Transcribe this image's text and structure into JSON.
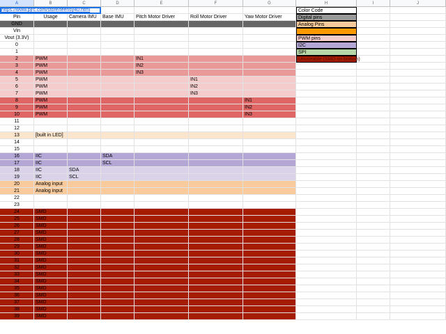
{
  "columns": [
    "A",
    "B",
    "C",
    "D",
    "E",
    "F",
    "G",
    "H",
    "I",
    "J"
  ],
  "selected_column": "A",
  "colors": {
    "digital": "#999999",
    "analog": "#f9cb9c",
    "pwm": "#f4cccc",
    "i2c": "#b4a7d6",
    "spi": "#b6d7a8",
    "smd": "#a61c00",
    "gnd_row": "#666666",
    "pwm_a": "#ea9999",
    "pwm_b": "#f4cccc",
    "pwm_c": "#e06666",
    "led_row": "#fce5cd",
    "i2c_row_a": "#b4a7d6",
    "i2c_row_b": "#d9d2e9",
    "analog_row": "#f9cb9c",
    "smd_row": "#a61c00"
  },
  "link_text": "https://www.pjrc.com/store/teensy40.html",
  "headers": {
    "pin": "Pin",
    "usage": "Usage",
    "camera_imu": "Camera IMU",
    "base_imu": "Base IMU",
    "pitch": "Pitch Motor Driver",
    "roll": "Roll  Motor Driver",
    "yaw": "Yaw Motor Driver"
  },
  "legend": {
    "title": "Color Code",
    "items": [
      {
        "label": "Digital pins",
        "color": "#999999",
        "text_color": "#000000"
      },
      {
        "label": "Analog Pins",
        "color": "#f9cb9c",
        "text_color": "#000000"
      },
      {
        "label": "",
        "color": "#ff9900",
        "text_color": "#000000"
      },
      {
        "label": "PWM pins",
        "color": "#f4cccc",
        "text_color": "#000000"
      },
      {
        "label": "I2C",
        "color": "#b4a7d6",
        "text_color": "#000000"
      },
      {
        "label": "SPI",
        "color": "#b6d7a8",
        "text_color": "#000000"
      },
      {
        "label": "Unuseable (SMD on bottom)",
        "color": "#a61c00",
        "text_color": "#5a0e00"
      }
    ]
  },
  "rows": [
    {
      "pin": "GND",
      "usage": "",
      "c": "",
      "d": "",
      "e": "",
      "f": "",
      "g": "",
      "bg": "#666666"
    },
    {
      "pin": "Vin",
      "usage": "",
      "c": "",
      "d": "",
      "e": "",
      "f": "",
      "g": "",
      "bg": ""
    },
    {
      "pin": "Vout (3.3V)",
      "usage": "",
      "c": "",
      "d": "",
      "e": "",
      "f": "",
      "g": "",
      "bg": ""
    },
    {
      "pin": "0",
      "usage": "",
      "c": "",
      "d": "",
      "e": "",
      "f": "",
      "g": "",
      "bg": ""
    },
    {
      "pin": "1",
      "usage": "",
      "c": "",
      "d": "",
      "e": "",
      "f": "",
      "g": "",
      "bg": ""
    },
    {
      "pin": "2",
      "usage": "PWM",
      "c": "",
      "d": "",
      "e": "IN1",
      "f": "",
      "g": "",
      "bg": "#ea9999"
    },
    {
      "pin": "3",
      "usage": "PWM",
      "c": "",
      "d": "",
      "e": "IN2",
      "f": "",
      "g": "",
      "bg": "#ea9999"
    },
    {
      "pin": "4",
      "usage": "PWM",
      "c": "",
      "d": "",
      "e": "IN3",
      "f": "",
      "g": "",
      "bg": "#ea9999"
    },
    {
      "pin": "5",
      "usage": "PWM",
      "c": "",
      "d": "",
      "e": "",
      "f": "IN1",
      "g": "",
      "bg": "#f4cccc"
    },
    {
      "pin": "6",
      "usage": "PWM",
      "c": "",
      "d": "",
      "e": "",
      "f": "IN2",
      "g": "",
      "bg": "#f4cccc"
    },
    {
      "pin": "7",
      "usage": "PWM",
      "c": "",
      "d": "",
      "e": "",
      "f": "IN3",
      "g": "",
      "bg": "#f4cccc"
    },
    {
      "pin": "8",
      "usage": "PWM",
      "c": "",
      "d": "",
      "e": "",
      "f": "",
      "g": "IN1",
      "bg": "#e06666"
    },
    {
      "pin": "9",
      "usage": "PWM",
      "c": "",
      "d": "",
      "e": "",
      "f": "",
      "g": "IN2",
      "bg": "#e06666"
    },
    {
      "pin": "10",
      "usage": "PWM",
      "c": "",
      "d": "",
      "e": "",
      "f": "",
      "g": "IN3",
      "bg": "#e06666"
    },
    {
      "pin": "11",
      "usage": "",
      "c": "",
      "d": "",
      "e": "",
      "f": "",
      "g": "",
      "bg": ""
    },
    {
      "pin": "12",
      "usage": "",
      "c": "",
      "d": "",
      "e": "",
      "f": "",
      "g": "",
      "bg": ""
    },
    {
      "pin": "13",
      "usage": "[built in LED]",
      "c": "",
      "d": "",
      "e": "",
      "f": "",
      "g": "",
      "bg": "#fce5cd"
    },
    {
      "pin": "14",
      "usage": "",
      "c": "",
      "d": "",
      "e": "",
      "f": "",
      "g": "",
      "bg": ""
    },
    {
      "pin": "15",
      "usage": "",
      "c": "",
      "d": "",
      "e": "",
      "f": "",
      "g": "",
      "bg": ""
    },
    {
      "pin": "16",
      "usage": "IIC",
      "c": "",
      "d": "SDA",
      "e": "",
      "f": "",
      "g": "",
      "bg": "#b4a7d6"
    },
    {
      "pin": "17",
      "usage": "IIC",
      "c": "",
      "d": "SCL",
      "e": "",
      "f": "",
      "g": "",
      "bg": "#b4a7d6"
    },
    {
      "pin": "18",
      "usage": "IIC",
      "c": "SDA",
      "d": "",
      "e": "",
      "f": "",
      "g": "",
      "bg": "#d9d2e9"
    },
    {
      "pin": "19",
      "usage": "IIC",
      "c": "SCL",
      "d": "",
      "e": "",
      "f": "",
      "g": "",
      "bg": "#d9d2e9"
    },
    {
      "pin": "20",
      "usage": "Analog input",
      "c": "",
      "d": "",
      "e": "",
      "f": "",
      "g": "",
      "bg": "#f9cb9c"
    },
    {
      "pin": "21",
      "usage": "Analog input",
      "c": "",
      "d": "",
      "e": "",
      "f": "",
      "g": "",
      "bg": "#f9cb9c"
    },
    {
      "pin": "22",
      "usage": "",
      "c": "",
      "d": "",
      "e": "",
      "f": "",
      "g": "",
      "bg": ""
    },
    {
      "pin": "23",
      "usage": "",
      "c": "",
      "d": "",
      "e": "",
      "f": "",
      "g": "",
      "bg": ""
    },
    {
      "pin": "24",
      "usage": "SMD",
      "c": "",
      "d": "",
      "e": "",
      "f": "",
      "g": "",
      "bg": "#a61c00"
    },
    {
      "pin": "25",
      "usage": "SMD",
      "c": "",
      "d": "",
      "e": "",
      "f": "",
      "g": "",
      "bg": "#a61c00"
    },
    {
      "pin": "26",
      "usage": "SMD",
      "c": "",
      "d": "",
      "e": "",
      "f": "",
      "g": "",
      "bg": "#a61c00"
    },
    {
      "pin": "27",
      "usage": "SMD",
      "c": "",
      "d": "",
      "e": "",
      "f": "",
      "g": "",
      "bg": "#a61c00"
    },
    {
      "pin": "28",
      "usage": "SMD",
      "c": "",
      "d": "",
      "e": "",
      "f": "",
      "g": "",
      "bg": "#a61c00"
    },
    {
      "pin": "29",
      "usage": "SMD",
      "c": "",
      "d": "",
      "e": "",
      "f": "",
      "g": "",
      "bg": "#a61c00"
    },
    {
      "pin": "30",
      "usage": "SMD",
      "c": "",
      "d": "",
      "e": "",
      "f": "",
      "g": "",
      "bg": "#a61c00"
    },
    {
      "pin": "31",
      "usage": "SMD",
      "c": "",
      "d": "",
      "e": "",
      "f": "",
      "g": "",
      "bg": "#a61c00"
    },
    {
      "pin": "32",
      "usage": "SMD",
      "c": "",
      "d": "",
      "e": "",
      "f": "",
      "g": "",
      "bg": "#a61c00"
    },
    {
      "pin": "33",
      "usage": "SMD",
      "c": "",
      "d": "",
      "e": "",
      "f": "",
      "g": "",
      "bg": "#a61c00"
    },
    {
      "pin": "34",
      "usage": "SMD",
      "c": "",
      "d": "",
      "e": "",
      "f": "",
      "g": "",
      "bg": "#a61c00"
    },
    {
      "pin": "35",
      "usage": "SMD",
      "c": "",
      "d": "",
      "e": "",
      "f": "",
      "g": "",
      "bg": "#a61c00"
    },
    {
      "pin": "36",
      "usage": "SMD",
      "c": "",
      "d": "",
      "e": "",
      "f": "",
      "g": "",
      "bg": "#a61c00"
    },
    {
      "pin": "37",
      "usage": "SMD",
      "c": "",
      "d": "",
      "e": "",
      "f": "",
      "g": "",
      "bg": "#a61c00"
    },
    {
      "pin": "38",
      "usage": "SMD",
      "c": "",
      "d": "",
      "e": "",
      "f": "",
      "g": "",
      "bg": "#a61c00"
    },
    {
      "pin": "39",
      "usage": "SMD",
      "c": "",
      "d": "",
      "e": "",
      "f": "",
      "g": "",
      "bg": "#a61c00"
    }
  ]
}
